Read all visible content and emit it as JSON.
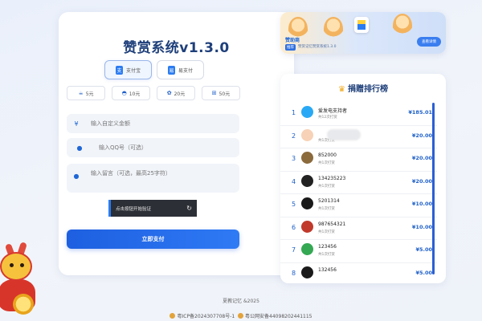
{
  "main": {
    "title": "赞赏系统v1.3.0",
    "pay_methods": [
      {
        "label": "支付宝",
        "icon": "alipay-icon",
        "active": true
      },
      {
        "label": "易支付",
        "icon": "epay-icon",
        "active": false
      }
    ],
    "amounts": [
      {
        "label": "5元",
        "icon": "coffee-icon"
      },
      {
        "label": "10元",
        "icon": "cake-icon"
      },
      {
        "label": "20元",
        "icon": "treat-icon"
      },
      {
        "label": "50元",
        "icon": "gift-icon"
      }
    ],
    "custom_amount_placeholder": "输入自定义金额",
    "currency_symbol": "¥",
    "qq_placeholder": "输入QQ号（可选）",
    "message_placeholder": "输入留言（可选，最高25字符）",
    "captcha_label": "点击按钮开始验证",
    "submit_label": "立即支付"
  },
  "banner": {
    "title": "赞助商",
    "tag": "推荐",
    "text": "赞赏记忆赞赏系统1.3.0",
    "button": "查看详情"
  },
  "ranking": {
    "title": "捐赠排行榜",
    "rows": [
      {
        "rank": "1",
        "name": "爱发电支持者",
        "count": "共12次打赏",
        "amount": "¥185.01",
        "avatar_color": "#29a9f5"
      },
      {
        "rank": "2",
        "name": "",
        "count": "共1次打赏",
        "amount": "¥20.00",
        "avatar_color": "#f7d2b6"
      },
      {
        "rank": "3",
        "name": "852000",
        "count": "共1次打赏",
        "amount": "¥20.00",
        "avatar_color": "#8b6a3c"
      },
      {
        "rank": "4",
        "name": "134235223",
        "count": "共1次打赏",
        "amount": "¥20.00",
        "avatar_color": "#222222"
      },
      {
        "rank": "5",
        "name": "5201314",
        "count": "共1次打赏",
        "amount": "¥10.00",
        "avatar_color": "#1a1a1a"
      },
      {
        "rank": "6",
        "name": "987654321",
        "count": "共1次打赏",
        "amount": "¥10.00",
        "avatar_color": "#c0392b"
      },
      {
        "rank": "7",
        "name": "123456",
        "count": "共1次打赏",
        "amount": "¥5.00",
        "avatar_color": "#34a853"
      },
      {
        "rank": "8",
        "name": "132456",
        "count": "",
        "amount": "¥5.00",
        "avatar_color": "#1a1a1a"
      }
    ]
  },
  "footer": {
    "copyright": "夏教记忆 &2025",
    "icp": "粤ICP备2024307708号-1",
    "police": "粤公网安备44098202441115"
  },
  "colors": {
    "accent": "#2b7cf1",
    "title": "#1e3f7a"
  }
}
